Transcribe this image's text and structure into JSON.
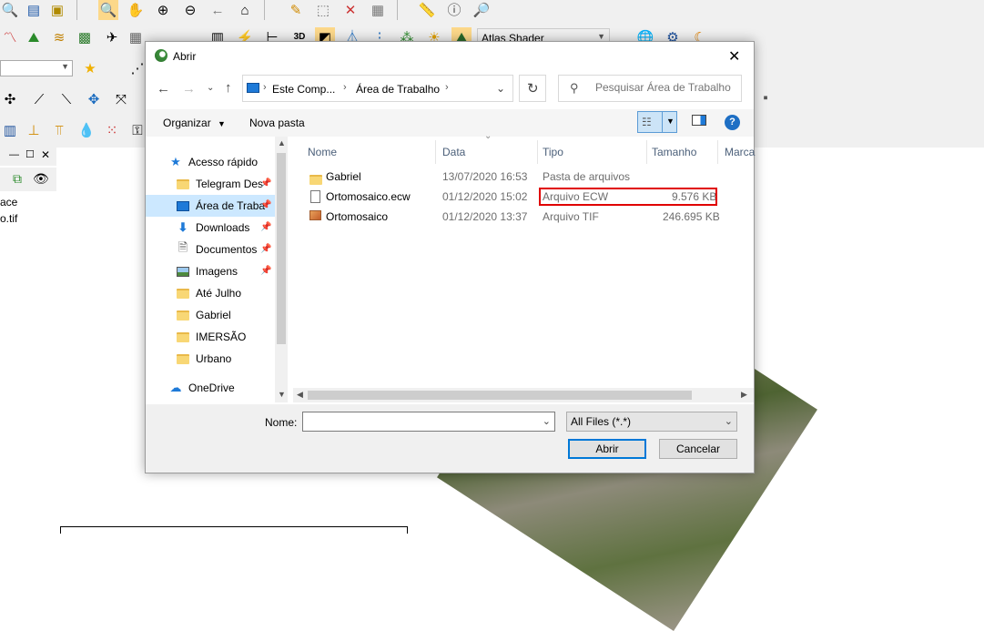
{
  "app": {
    "layer_items": [
      "ace",
      "o.tif"
    ],
    "shader_label": "Atlas Shader"
  },
  "dialog": {
    "title": "Abrir",
    "breadcrumb": [
      "Este Comp...",
      "Área de Trabalho"
    ],
    "search_placeholder": "Pesquisar Área de Trabalho",
    "organize_label": "Organizar",
    "new_folder_label": "Nova pasta",
    "help_glyph": "?",
    "nav_items": [
      {
        "label": "Acesso rápido",
        "icon": "star-icon",
        "pinned": false
      },
      {
        "label": "Telegram Des",
        "icon": "folder-icon",
        "pinned": true
      },
      {
        "label": "Área de Traba",
        "icon": "desktop-icon",
        "pinned": true,
        "selected": true
      },
      {
        "label": "Downloads",
        "icon": "download-icon",
        "pinned": true
      },
      {
        "label": "Documentos",
        "icon": "document-icon",
        "pinned": true
      },
      {
        "label": "Imagens",
        "icon": "image-icon",
        "pinned": true
      },
      {
        "label": "Até Julho",
        "icon": "folder-icon",
        "pinned": false
      },
      {
        "label": "Gabriel",
        "icon": "folder-icon",
        "pinned": false
      },
      {
        "label": "IMERSÃO",
        "icon": "folder-icon",
        "pinned": false
      },
      {
        "label": "Urbano",
        "icon": "folder-icon",
        "pinned": false
      },
      {
        "label": "OneDrive",
        "icon": "cloud-icon",
        "pinned": false
      }
    ],
    "columns": [
      "Nome",
      "Data",
      "Tipo",
      "Tamanho",
      "Marca"
    ],
    "files": [
      {
        "name": "Gabriel",
        "date": "13/07/2020 16:53",
        "type": "Pasta de arquivos",
        "size": "",
        "icon": "folder-icon"
      },
      {
        "name": "Ortomosaico.ecw",
        "date": "01/12/2020 15:02",
        "type": "Arquivo ECW",
        "size": "9.576 KB",
        "icon": "file-icon"
      },
      {
        "name": "Ortomosaico",
        "date": "01/12/2020 13:37",
        "type": "Arquivo TIF",
        "size": "246.695 KB",
        "icon": "image-file-icon"
      }
    ],
    "filename_label": "Nome:",
    "filename_value": "",
    "filter_value": "All Files (*.*)",
    "open_label": "Abrir",
    "cancel_label": "Cancelar",
    "highlight_color": "#e00000"
  }
}
